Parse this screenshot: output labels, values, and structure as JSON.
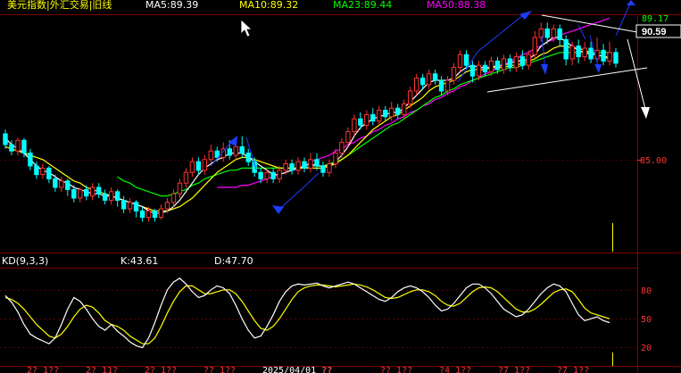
{
  "header": {
    "title": "美元指数|外汇交易|旧线",
    "ma5": "MA5:89.39",
    "ma10": "MA10:89.32",
    "ma23": "MA23:89.44",
    "ma50": "MA50:88.38"
  },
  "price_axis": {
    "current_price": "90.59",
    "label_top": "89.17",
    "label_mid": "85.00"
  },
  "kd_panel": {
    "title": "KD(9,3,3)",
    "k_label": "K:43.61",
    "d_label": "D:47.70",
    "ticks": [
      "80",
      "50",
      "20"
    ]
  },
  "x_axis": {
    "ticks": [
      "2? 1??",
      "2? 11?",
      "2? 1??",
      "?? 1??",
      "2025/04/01 ??",
      "??",
      "?? 1??",
      "?4 1??",
      "?7 1??",
      "?7 1??"
    ]
  },
  "colors": {
    "up": "#ff3232",
    "down": "#00ffff",
    "ma5": "#ffffff",
    "ma10": "#ffff00",
    "ma23": "#00ff00",
    "ma50": "#ff00ff",
    "grid": "#7a0000",
    "trend_blue": "#1e3cff",
    "trend_white": "#ffffff"
  },
  "chart_data": {
    "type": "candlestick",
    "ylim": [
      80.6,
      91.6
    ],
    "kd_ylim": [
      0,
      100
    ],
    "candles": [
      [
        86.1,
        85.6,
        86.3,
        85.4
      ],
      [
        85.6,
        85.3,
        85.8,
        85.1
      ],
      [
        85.3,
        85.8,
        85.9,
        85.1
      ],
      [
        85.8,
        85.2,
        85.9,
        85.0
      ],
      [
        85.2,
        84.6,
        85.4,
        84.4
      ],
      [
        84.6,
        84.2,
        84.8,
        84.0
      ],
      [
        84.2,
        84.5,
        84.7,
        84.0
      ],
      [
        84.5,
        84.0,
        84.6,
        83.8
      ],
      [
        84.0,
        83.6,
        84.2,
        83.4
      ],
      [
        83.6,
        83.9,
        84.1,
        83.4
      ],
      [
        83.9,
        83.5,
        84.0,
        83.2
      ],
      [
        83.5,
        83.1,
        83.7,
        82.9
      ],
      [
        83.1,
        83.5,
        83.6,
        82.9
      ],
      [
        83.5,
        83.2,
        83.7,
        83.0
      ],
      [
        83.2,
        83.6,
        83.8,
        83.0
      ],
      [
        83.6,
        83.3,
        83.8,
        83.1
      ],
      [
        83.3,
        83.0,
        83.5,
        82.8
      ],
      [
        83.0,
        83.4,
        83.6,
        82.8
      ],
      [
        83.4,
        83.0,
        83.5,
        82.7
      ],
      [
        83.0,
        82.6,
        83.2,
        82.4
      ],
      [
        82.6,
        82.9,
        83.1,
        82.4
      ],
      [
        82.9,
        82.5,
        83.0,
        82.2
      ],
      [
        82.5,
        82.2,
        82.7,
        82.0
      ],
      [
        82.2,
        82.5,
        82.7,
        82.0
      ],
      [
        82.5,
        82.2,
        82.6,
        82.0
      ],
      [
        82.2,
        82.6,
        82.8,
        82.1
      ],
      [
        82.6,
        82.9,
        83.1,
        82.4
      ],
      [
        82.9,
        83.3,
        83.5,
        82.7
      ],
      [
        83.3,
        83.8,
        84.0,
        83.1
      ],
      [
        83.8,
        84.3,
        84.5,
        83.6
      ],
      [
        84.3,
        84.8,
        85.0,
        84.1
      ],
      [
        84.8,
        84.4,
        85.0,
        84.2
      ],
      [
        84.4,
        84.9,
        85.1,
        84.2
      ],
      [
        84.9,
        85.3,
        85.6,
        84.7
      ],
      [
        85.3,
        85.0,
        85.5,
        84.8
      ],
      [
        85.0,
        85.4,
        85.7,
        84.8
      ],
      [
        85.4,
        85.1,
        85.8,
        84.9
      ],
      [
        85.1,
        85.5,
        85.7,
        84.9
      ],
      [
        85.5,
        85.2,
        86.0,
        85.0
      ],
      [
        85.2,
        84.8,
        85.4,
        84.6
      ],
      [
        84.8,
        84.3,
        85.0,
        84.1
      ],
      [
        84.3,
        84.0,
        84.5,
        83.8
      ],
      [
        84.0,
        84.3,
        84.5,
        83.8
      ],
      [
        84.3,
        84.0,
        84.5,
        83.8
      ],
      [
        84.0,
        84.4,
        84.6,
        83.8
      ],
      [
        84.4,
        84.7,
        84.9,
        84.2
      ],
      [
        84.7,
        84.4,
        84.9,
        84.2
      ],
      [
        84.4,
        84.8,
        85.0,
        84.2
      ],
      [
        84.8,
        84.5,
        85.0,
        84.3
      ],
      [
        84.5,
        84.9,
        85.2,
        84.3
      ],
      [
        84.9,
        84.6,
        85.2,
        84.4
      ],
      [
        84.6,
        84.3,
        84.8,
        84.1
      ],
      [
        84.3,
        84.7,
        84.9,
        84.1
      ],
      [
        84.7,
        85.2,
        85.4,
        84.5
      ],
      [
        85.2,
        85.7,
        85.9,
        85.0
      ],
      [
        85.7,
        86.2,
        86.4,
        85.5
      ],
      [
        86.2,
        86.8,
        87.0,
        86.0
      ],
      [
        86.8,
        86.5,
        87.1,
        86.3
      ],
      [
        86.5,
        87.0,
        87.2,
        86.3
      ],
      [
        87.0,
        86.7,
        87.3,
        86.5
      ],
      [
        86.7,
        87.2,
        87.4,
        86.5
      ],
      [
        87.2,
        86.9,
        87.4,
        86.7
      ],
      [
        86.9,
        87.3,
        87.6,
        86.7
      ],
      [
        87.3,
        87.0,
        87.5,
        86.8
      ],
      [
        87.0,
        87.5,
        87.7,
        86.8
      ],
      [
        87.5,
        88.1,
        88.3,
        87.3
      ],
      [
        88.1,
        88.7,
        88.9,
        87.9
      ],
      [
        88.7,
        88.4,
        88.9,
        88.2
      ],
      [
        88.4,
        88.9,
        89.1,
        88.2
      ],
      [
        88.9,
        88.6,
        89.1,
        88.4
      ],
      [
        88.6,
        88.1,
        88.8,
        87.9
      ],
      [
        88.1,
        88.6,
        88.8,
        87.9
      ],
      [
        88.6,
        89.2,
        89.4,
        88.4
      ],
      [
        89.2,
        89.8,
        90.0,
        89.0
      ],
      [
        89.8,
        89.3,
        90.0,
        89.1
      ],
      [
        89.3,
        88.8,
        89.5,
        88.5
      ],
      [
        88.8,
        89.3,
        89.5,
        88.6
      ],
      [
        89.3,
        89.0,
        89.5,
        88.8
      ],
      [
        89.0,
        89.5,
        89.7,
        88.8
      ],
      [
        89.5,
        89.1,
        89.7,
        88.9
      ],
      [
        89.1,
        89.6,
        89.8,
        88.9
      ],
      [
        89.6,
        89.2,
        89.8,
        89.0
      ],
      [
        89.2,
        89.7,
        89.9,
        89.0
      ],
      [
        89.7,
        89.3,
        90.0,
        89.1
      ],
      [
        89.3,
        89.8,
        90.0,
        89.1
      ],
      [
        89.8,
        90.6,
        90.9,
        89.6
      ],
      [
        90.6,
        91.0,
        91.3,
        90.4
      ],
      [
        91.0,
        90.6,
        91.3,
        90.3
      ],
      [
        90.6,
        91.0,
        91.2,
        90.4
      ],
      [
        91.0,
        90.5,
        91.2,
        90.2
      ],
      [
        90.5,
        89.6,
        90.7,
        89.3
      ],
      [
        89.6,
        90.2,
        90.4,
        89.3
      ],
      [
        90.2,
        89.7,
        90.5,
        89.4
      ],
      [
        89.7,
        90.1,
        90.4,
        89.5
      ],
      [
        90.1,
        89.6,
        90.4,
        89.4
      ],
      [
        89.6,
        90.0,
        90.6,
        89.4
      ],
      [
        90.0,
        89.5,
        90.3,
        89.3
      ],
      [
        89.5,
        89.9,
        90.4,
        89.3
      ],
      [
        89.9,
        89.4,
        90.1,
        89.2
      ]
    ],
    "ma5": [
      85.9,
      85.6,
      85.4,
      85.2,
      84.9,
      84.6,
      84.4,
      84.3,
      84.1,
      83.9,
      83.8,
      83.6,
      83.5,
      83.4,
      83.3,
      83.3,
      83.2,
      83.2,
      83.1,
      83.0,
      82.9,
      82.8,
      82.7,
      82.5,
      82.4,
      82.4,
      82.5,
      82.7,
      83.0,
      83.4,
      83.8,
      84.2,
      84.5,
      84.7,
      84.9,
      85.0,
      85.2,
      85.2,
      85.2,
      85.0,
      84.8,
      84.6,
      84.4,
      84.2,
      84.2,
      84.3,
      84.4,
      84.5,
      84.6,
      84.7,
      84.6,
      84.6,
      84.6,
      84.8,
      85.1,
      85.5,
      86.0,
      86.4,
      86.6,
      86.8,
      86.9,
      87.0,
      87.1,
      87.1,
      87.3,
      87.6,
      87.9,
      88.2,
      88.5,
      88.6,
      88.6,
      88.6,
      88.7,
      89.0,
      89.2,
      89.3,
      89.2,
      89.2,
      89.2,
      89.3,
      89.3,
      89.4,
      89.5,
      89.5,
      89.6,
      89.8,
      90.2,
      90.4,
      90.6,
      90.6,
      90.4,
      90.2,
      90.0,
      89.9,
      89.8,
      89.8,
      89.7,
      89.6
    ],
    "ma10": [
      85.5,
      85.4,
      85.3,
      85.2,
      85.1,
      85.0,
      84.9,
      84.7,
      84.5,
      84.3,
      84.1,
      83.9,
      83.8,
      83.6,
      83.5,
      83.4,
      83.3,
      83.2,
      83.1,
      83.0,
      82.9,
      82.8,
      82.7,
      82.6,
      82.5,
      82.5,
      82.5,
      82.6,
      82.7,
      82.9,
      83.1,
      83.4,
      83.7,
      84.0,
      84.3,
      84.5,
      84.7,
      84.9,
      85.0,
      85.0,
      84.9,
      84.8,
      84.7,
      84.6,
      84.5,
      84.5,
      84.5,
      84.5,
      84.5,
      84.5,
      84.5,
      84.5,
      84.6,
      84.7,
      84.9,
      85.1,
      85.4,
      85.7,
      86.0,
      86.3,
      86.5,
      86.7,
      86.9,
      87.0,
      87.2,
      87.4,
      87.6,
      87.8,
      88.1,
      88.3,
      88.4,
      88.5,
      88.6,
      88.8,
      89.0,
      89.1,
      89.1,
      89.1,
      89.2,
      89.2,
      89.2,
      89.3,
      89.3,
      89.4,
      89.5,
      89.6,
      89.8,
      89.9,
      90.1,
      90.2,
      90.2,
      90.1,
      90.1,
      90.0,
      89.9,
      89.8,
      89.7,
      89.7
    ],
    "ma23": [
      null,
      null,
      null,
      null,
      null,
      null,
      null,
      null,
      null,
      null,
      null,
      null,
      null,
      null,
      null,
      null,
      null,
      null,
      84.1,
      83.9,
      83.8,
      83.6,
      83.5,
      83.4,
      83.3,
      83.2,
      83.2,
      83.3,
      83.4,
      83.5,
      83.7,
      83.8,
      84.0,
      84.1,
      84.2,
      84.3,
      84.4,
      84.4,
      84.5,
      84.5,
      84.5,
      84.5,
      84.5,
      84.5,
      84.5,
      84.5,
      84.5,
      84.5,
      84.5,
      84.6,
      84.6,
      84.6,
      84.7,
      84.8,
      84.9,
      85.1,
      85.3,
      85.5,
      85.7,
      85.9,
      86.1,
      86.3,
      86.5,
      86.6,
      86.8,
      87.0,
      87.2,
      87.4,
      87.6,
      87.8,
      87.9,
      88.1,
      88.2,
      88.4,
      88.5,
      88.6,
      88.7,
      88.8,
      88.9,
      89.0,
      89.1,
      89.2,
      89.2,
      89.3,
      89.4,
      89.5,
      89.6,
      89.7,
      89.8,
      89.9,
      89.9,
      89.9,
      89.9,
      89.9,
      89.9,
      89.9,
      89.9,
      89.9
    ],
    "ma50": [
      null,
      null,
      null,
      null,
      null,
      null,
      null,
      null,
      null,
      null,
      null,
      null,
      null,
      null,
      null,
      null,
      null,
      null,
      null,
      null,
      null,
      null,
      null,
      null,
      null,
      null,
      null,
      null,
      null,
      null,
      null,
      null,
      null,
      null,
      83.6,
      83.6,
      83.6,
      83.6,
      83.7,
      83.7,
      83.8,
      83.9,
      84.0,
      84.1,
      84.2,
      84.3,
      84.4,
      84.5,
      84.6,
      84.8,
      84.9,
      85.0,
      85.1,
      85.3,
      85.4,
      85.6,
      85.7,
      85.9,
      86.0,
      86.2,
      86.3,
      86.5,
      86.6,
      86.8,
      86.9,
      87.1,
      87.2,
      87.4,
      87.5,
      87.7,
      87.8,
      88.0,
      88.1,
      88.3,
      88.4,
      88.6,
      88.7,
      88.9,
      89.0,
      89.2,
      89.3,
      89.5,
      89.6,
      89.8,
      89.9,
      90.1,
      90.2,
      90.4,
      90.5,
      90.7,
      90.8,
      90.9,
      91.0,
      91.1,
      91.2,
      91.3,
      91.4,
      91.5
    ],
    "k": [
      72,
      65,
      55,
      42,
      32,
      28,
      25,
      22,
      28,
      42,
      58,
      70,
      66,
      58,
      48,
      40,
      36,
      42,
      35,
      30,
      24,
      20,
      18,
      28,
      44,
      62,
      78,
      86,
      90,
      84,
      76,
      70,
      72,
      78,
      82,
      80,
      74,
      62,
      48,
      36,
      28,
      30,
      40,
      52,
      66,
      76,
      82,
      84,
      83,
      84,
      85,
      82,
      80,
      82,
      84,
      86,
      84,
      80,
      76,
      72,
      68,
      66,
      70,
      76,
      80,
      82,
      80,
      76,
      70,
      62,
      56,
      58,
      64,
      72,
      80,
      84,
      84,
      80,
      74,
      66,
      58,
      54,
      50,
      52,
      58,
      66,
      74,
      80,
      84,
      82,
      76,
      64,
      52,
      46,
      48,
      50,
      46,
      44
    ],
    "d": [
      70,
      68,
      64,
      58,
      50,
      42,
      36,
      30,
      28,
      32,
      40,
      50,
      58,
      62,
      60,
      54,
      46,
      42,
      40,
      36,
      30,
      26,
      22,
      22,
      28,
      40,
      54,
      66,
      76,
      82,
      82,
      78,
      74,
      74,
      76,
      78,
      78,
      74,
      66,
      56,
      46,
      38,
      36,
      40,
      48,
      58,
      68,
      76,
      80,
      82,
      83,
      83,
      82,
      81,
      82,
      83,
      84,
      83,
      81,
      78,
      74,
      70,
      69,
      70,
      73,
      76,
      78,
      78,
      76,
      72,
      66,
      62,
      61,
      64,
      70,
      76,
      80,
      81,
      80,
      76,
      70,
      64,
      58,
      55,
      55,
      58,
      63,
      69,
      75,
      78,
      79,
      76,
      68,
      59,
      54,
      52,
      50,
      48
    ]
  }
}
